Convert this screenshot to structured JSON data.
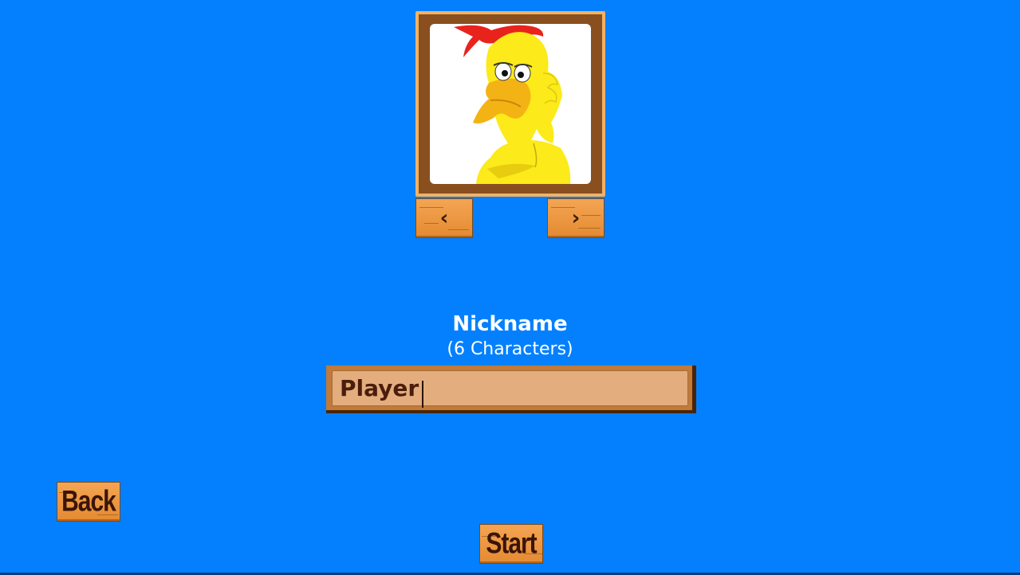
{
  "character_select": {
    "portrait": "rooster-character",
    "prev_glyph": "‹",
    "next_glyph": "›"
  },
  "nickname": {
    "title": "Nickname",
    "hint": "(6 Characters)",
    "value": "Player"
  },
  "buttons": {
    "back": "Back",
    "start": "Start"
  },
  "colors": {
    "background": "#0480fe",
    "wood": "#e48a32",
    "text_dark": "#3a1408"
  }
}
